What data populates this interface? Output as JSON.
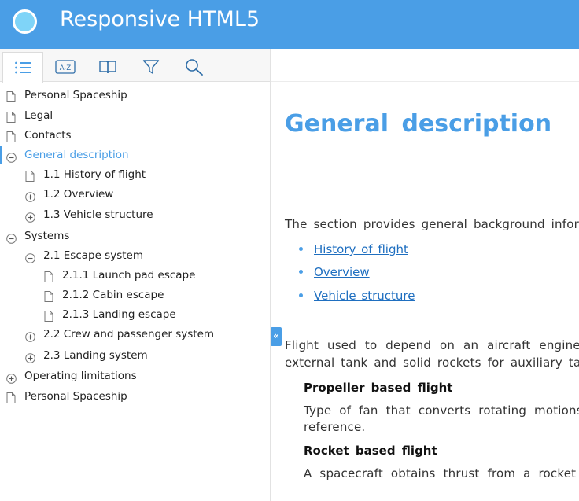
{
  "header": {
    "title": "Responsive HTML5"
  },
  "toolbar": {
    "tabs": [
      {
        "name": "contents",
        "icon": "list-icon",
        "active": true
      },
      {
        "name": "index",
        "icon": "a-z-index-icon",
        "label": "A-Z"
      },
      {
        "name": "glossary",
        "icon": "book-icon"
      },
      {
        "name": "filter",
        "icon": "filter-icon"
      },
      {
        "name": "search",
        "icon": "search-icon"
      }
    ]
  },
  "toc": [
    {
      "label": "Personal Spaceship",
      "level": 0,
      "icon": "page-icon"
    },
    {
      "label": "Legal",
      "level": 0,
      "icon": "page-icon"
    },
    {
      "label": "Contacts",
      "level": 0,
      "icon": "page-icon"
    },
    {
      "label": "General description",
      "level": 0,
      "icon": "collapse-icon",
      "selected": true
    },
    {
      "label": "1.1 History of flight",
      "level": 1,
      "icon": "page-icon"
    },
    {
      "label": "1.2 Overview",
      "level": 1,
      "icon": "expand-icon"
    },
    {
      "label": "1.3 Vehicle structure",
      "level": 1,
      "icon": "expand-icon"
    },
    {
      "label": "Systems",
      "level": 0,
      "icon": "collapse-icon"
    },
    {
      "label": "2.1 Escape system",
      "level": 1,
      "icon": "collapse-icon"
    },
    {
      "label": "2.1.1 Launch pad escape",
      "level": 2,
      "icon": "page-icon"
    },
    {
      "label": "2.1.2 Cabin escape",
      "level": 2,
      "icon": "page-icon"
    },
    {
      "label": "2.1.3 Landing escape",
      "level": 2,
      "icon": "page-icon"
    },
    {
      "label": "2.2 Crew and passenger system",
      "level": 1,
      "icon": "expand-icon"
    },
    {
      "label": "2.3 Landing system",
      "level": 1,
      "icon": "expand-icon"
    },
    {
      "label": "Operating limitations",
      "level": 0,
      "icon": "expand-icon"
    },
    {
      "label": "Personal Spaceship",
      "level": 0,
      "icon": "page-icon"
    }
  ],
  "collapse_handle": "«",
  "content": {
    "title": "General description",
    "intro": "The section provides general background informat",
    "links": [
      "History of flight",
      "Overview",
      "Vehicle structure"
    ],
    "flight_para_1": "Flight used to depend on an aircraft engine an",
    "flight_para_2": "external tank and solid rockets for auxiliary takeo",
    "sub1_title": "Propeller based flight",
    "sub1_line1": "Type of fan that converts rotating motions",
    "sub1_line2": "reference.",
    "sub2_title": "Rocket based flight",
    "sub2_line1": "A spacecraft obtains thrust from a rocket engi"
  },
  "colors": {
    "accent": "#4a9ee6",
    "link": "#1f6fc0"
  }
}
